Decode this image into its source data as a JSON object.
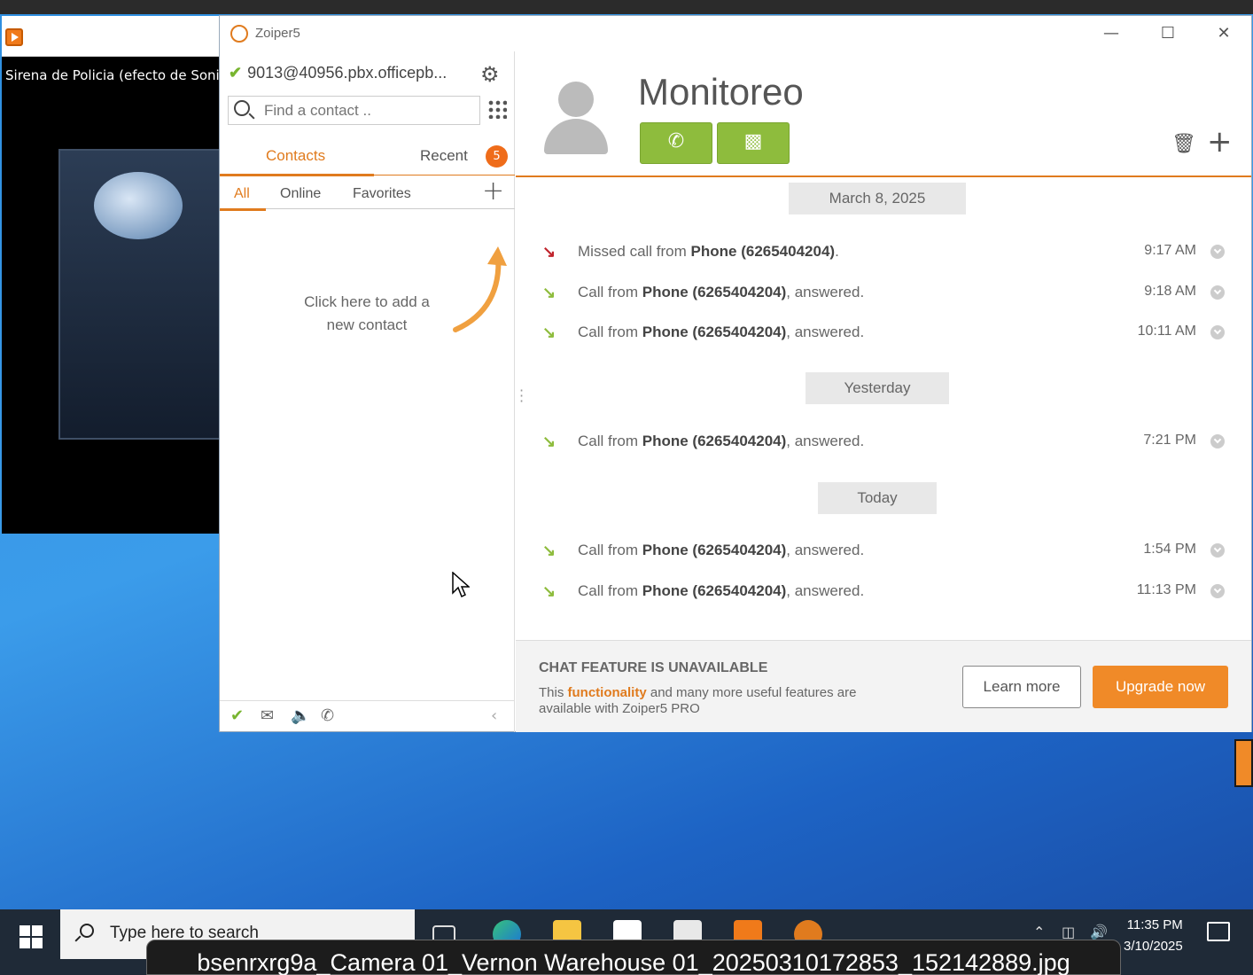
{
  "media_player": {
    "title": "Sirena de Policia (efecto de Sonido)"
  },
  "zoiper": {
    "window_title": "Zoiper5",
    "account": "9013@40956.pbx.officepb...",
    "search": {
      "placeholder": "Find a contact .."
    },
    "tabs": {
      "contacts": "Contacts",
      "recent": "Recent",
      "recent_badge": "5"
    },
    "subtabs": {
      "all": "All",
      "online": "Online",
      "favorites": "Favorites"
    },
    "empty_hint": "Click here to add a new contact",
    "contact": {
      "name": "Monitoreo"
    },
    "history": {
      "groups": [
        {
          "label": "March 8, 2025",
          "entries": [
            {
              "type": "missed",
              "prefix": "Missed call from ",
              "caller": "Phone (6265404204)",
              "suffix": ".",
              "time": "9:17 AM"
            },
            {
              "type": "answered",
              "prefix": "Call from ",
              "caller": "Phone (6265404204)",
              "suffix": ", answered.",
              "time": "9:18 AM"
            },
            {
              "type": "answered",
              "prefix": "Call from ",
              "caller": "Phone (6265404204)",
              "suffix": ", answered.",
              "time": "10:11 AM"
            }
          ]
        },
        {
          "label": "Yesterday",
          "entries": [
            {
              "type": "answered",
              "prefix": "Call from ",
              "caller": "Phone (6265404204)",
              "suffix": ", answered.",
              "time": "7:21 PM"
            }
          ]
        },
        {
          "label": "Today",
          "entries": [
            {
              "type": "answered",
              "prefix": "Call from ",
              "caller": "Phone (6265404204)",
              "suffix": ", answered.",
              "time": "1:54 PM"
            },
            {
              "type": "answered",
              "prefix": "Call from ",
              "caller": "Phone (6265404204)",
              "suffix": ", answered.",
              "time": "11:13 PM"
            }
          ]
        }
      ]
    },
    "chat": {
      "title": "CHAT FEATURE IS UNAVAILABLE",
      "desc_pre": "This ",
      "desc_hl": "functionality",
      "desc_post": " and many more useful features are available with Zoiper5 PRO",
      "learn_more": "Learn more",
      "upgrade": "Upgrade now"
    }
  },
  "taskbar": {
    "search_placeholder": "Type here to search",
    "time": "11:35 PM",
    "date": "3/10/2025"
  },
  "overlay_filename": "bsenrxrg9a_Camera 01_Vernon Warehouse 01_20250310172853_152142889.jpg",
  "colors": {
    "accent": "#e07b1e",
    "call_green": "#8ebc3d",
    "missed_red": "#c0242c",
    "upgrade_orange": "#f08a28"
  }
}
